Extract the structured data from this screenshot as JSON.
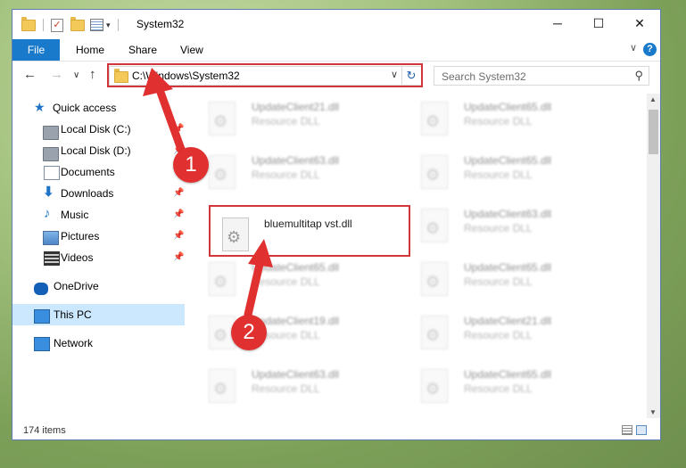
{
  "window": {
    "title": "System32",
    "minimize": "─",
    "maximize": "☐",
    "close": "✕"
  },
  "ribbon": {
    "file": "File",
    "home": "Home",
    "share": "Share",
    "view": "View",
    "help": "?"
  },
  "address": {
    "path": "C:\\Windows\\System32",
    "search_placeholder": "Search System32"
  },
  "nav": {
    "items": [
      {
        "label": "Quick access",
        "icon": "star-icon"
      },
      {
        "label": "Local Disk (C:)",
        "icon": "drive-icon"
      },
      {
        "label": "Local Disk (D:)",
        "icon": "drive-icon"
      },
      {
        "label": "Documents",
        "icon": "documents-icon"
      },
      {
        "label": "Downloads",
        "icon": "download-icon"
      },
      {
        "label": "Music",
        "icon": "music-icon"
      },
      {
        "label": "Pictures",
        "icon": "pictures-icon"
      },
      {
        "label": "Videos",
        "icon": "videos-icon"
      },
      {
        "label": "OneDrive",
        "icon": "cloud-icon"
      },
      {
        "label": "This PC",
        "icon": "computer-icon"
      },
      {
        "label": "Network",
        "icon": "network-icon"
      }
    ]
  },
  "files": {
    "highlighted": {
      "name": "bluemultitap vst.dll"
    },
    "items": [
      {
        "name": "UpdateClient21.dll",
        "type": "Resource DLL"
      },
      {
        "name": "UpdateClient65.dll",
        "type": "Resource DLL"
      },
      {
        "name": "UpdateClient63.dll",
        "type": "Resource DLL"
      },
      {
        "name": "UpdateClient65.dll",
        "type": "Resource DLL"
      },
      {
        "name": "UpdateClient63.dll",
        "type": "Resource DLL"
      },
      {
        "name": "UpdateClient65.dll",
        "type": "Resource DLL"
      },
      {
        "name": "UpdateClient65.dll",
        "type": "Resource DLL"
      },
      {
        "name": "UpdateClient19.dll",
        "type": "Resource DLL"
      },
      {
        "name": "UpdateClient21.dll",
        "type": "Resource DLL"
      },
      {
        "name": "UpdateClient63.dll",
        "type": "Resource DLL"
      },
      {
        "name": "UpdateClient65.dll",
        "type": "Resource DLL"
      }
    ]
  },
  "status": {
    "count": "174 items"
  },
  "annotations": {
    "step1": "1",
    "step2": "2",
    "color": "#d2353a"
  }
}
